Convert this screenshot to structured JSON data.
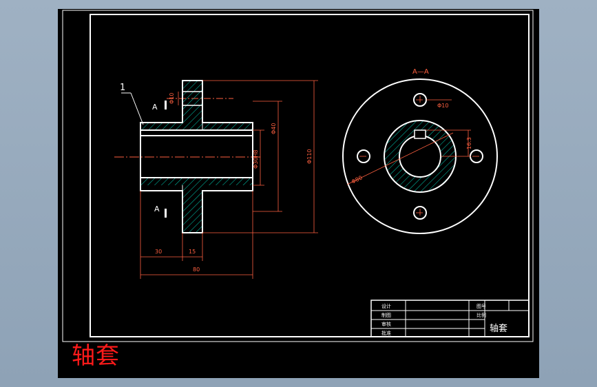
{
  "caption": "轴套",
  "title_block": {
    "rows": [
      "设计",
      "制图",
      "审核",
      "批准"
    ],
    "mid_labels": [
      "图号",
      "比例"
    ],
    "part_name": "轴套"
  },
  "front_view": {
    "leader_number": "1",
    "section_marker_top": "A",
    "section_marker_bottom": "A",
    "dims": {
      "flange_thickness": "15",
      "hub_length": "30",
      "total_length": "80",
      "bolt_hole": "Φ10",
      "hub_dia": "Φ40",
      "bore_dia": "Φ30H8",
      "flange_dia": "Φ110"
    }
  },
  "side_view": {
    "section_label": "A—A",
    "hole_dia": "Φ10",
    "keyway_depth": "16.3",
    "pcd": "Φ80"
  },
  "colors": {
    "frame": "#ffffff",
    "dimension": "#ff6040",
    "hatch": "#00c0a8",
    "caption": "#ff1a1a",
    "background": "#000000"
  }
}
